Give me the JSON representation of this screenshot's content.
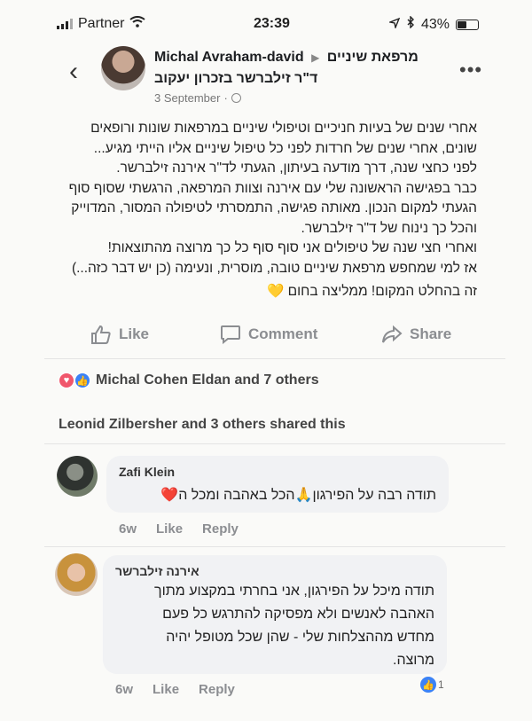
{
  "status_bar": {
    "carrier": "Partner",
    "time": "23:39",
    "battery": "43%"
  },
  "post": {
    "author": "Michal Avraham-david",
    "page": "מרפאת שיניים",
    "page_full": "ד\"ר זילברשר בזכרון יעקוב",
    "date": "3 September",
    "lines": [
      "אחרי שנים של בעיות חניכיים וטיפולי שיניים במרפאות שונות ורופאים",
      "שונים, אחרי שנים של חרדות לפני כל טיפול שיניים אליו הייתי מגיע...",
      "לפני כחצי שנה, דרך מודעה בעיתון, הגעתי לד\"ר אירנה זילברשר.",
      "כבר בפגישה הראשונה שלי עם אירנה וצוות המרפאה, הרגשתי שסוף סוף",
      "הגעתי למקום הנכון. מאותה פגישה, התמסרתי לטיפולה המסור, המדוייק",
      "והכל כך נינוח של ד\"ר זילברשר.",
      "ואחרי חצי שנה של טיפולים אני סוף סוף כל כך מרוצה מהתוצאות!",
      "אז למי שמחפש מרפאת שיניים טובה, מוסרית, ונעימה (כן יש דבר כזה...)",
      "זה בהחלט המקום! ממליצה בחום"
    ],
    "end_emoji": "💛"
  },
  "actions": {
    "like": "Like",
    "comment": "Comment",
    "share": "Share"
  },
  "reactions": {
    "text": "Michal Cohen Eldan and 7 others"
  },
  "shared": "Leonid Zilbersher and 3 others shared this",
  "comments": [
    {
      "name": "Zafi Klein",
      "text": "תודה רבה על הפירגון🙏הכל באהבה ומכל ה❤️",
      "time": "6w",
      "like": "Like",
      "reply": "Reply"
    },
    {
      "name": "אירנה זילברשר",
      "lines": [
        "תודה מיכל  על הפירגון, אני בחרתי במקצוע מתוך",
        "האהבה לאנשים ולא מפסיקה להתרגש כל פעם",
        "מחדש מההצלחות שלי - שהן שכל מטופל יהיה",
        "מרוצה."
      ],
      "time": "6w",
      "like": "Like",
      "reply": "Reply",
      "like_count": "1"
    }
  ],
  "colors": {
    "like_blue": "#3b82f6",
    "love_red": "#f0566b",
    "muted": "#8b8d91"
  }
}
